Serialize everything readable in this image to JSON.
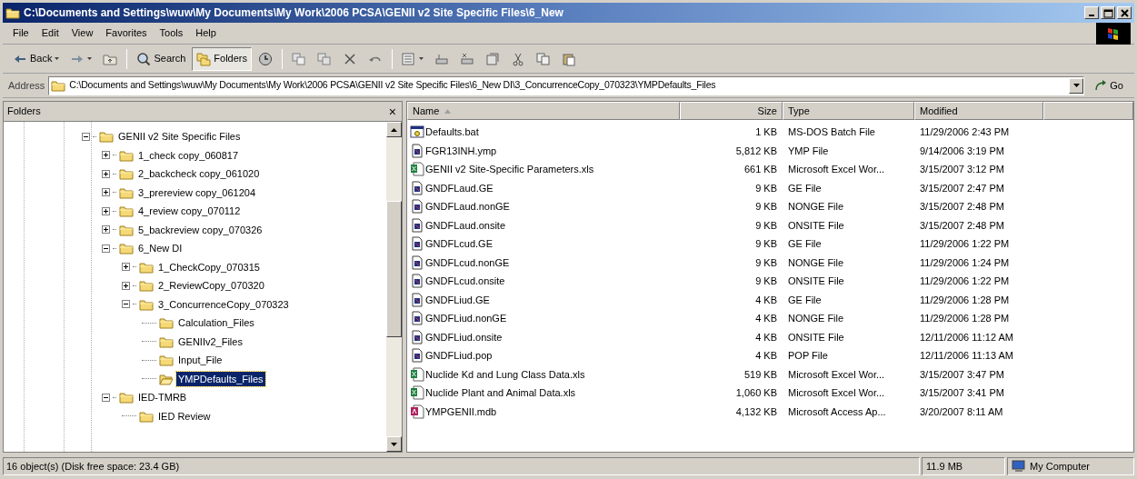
{
  "window": {
    "title": "C:\\Documents and Settings\\wuw\\My Documents\\My Work\\2006 PCSA\\GENII v2 Site Specific Files\\6_New"
  },
  "menu": [
    "File",
    "Edit",
    "View",
    "Favorites",
    "Tools",
    "Help"
  ],
  "toolbar": [
    {
      "kind": "back",
      "label": "Back",
      "pressed": false
    },
    {
      "kind": "forward",
      "pressed": false
    },
    {
      "kind": "up",
      "pressed": false
    },
    {
      "kind": "search",
      "label": "Search",
      "pressed": false
    },
    {
      "kind": "folders",
      "label": "Folders",
      "pressed": true
    },
    {
      "kind": "history",
      "pressed": false
    },
    {
      "kind": "moveto",
      "pressed": false
    },
    {
      "kind": "copyto",
      "pressed": false
    },
    {
      "kind": "delete",
      "pressed": false
    },
    {
      "kind": "undo",
      "pressed": false
    },
    {
      "kind": "views",
      "pressed": false
    },
    {
      "kind": "map",
      "pressed": false
    },
    {
      "kind": "unmap",
      "pressed": false
    },
    {
      "kind": "properties",
      "pressed": false
    },
    {
      "kind": "cut",
      "pressed": false
    },
    {
      "kind": "copy",
      "pressed": false
    },
    {
      "kind": "paste",
      "pressed": false
    }
  ],
  "address": {
    "label": "Address",
    "value": "C:\\Documents and Settings\\wuw\\My Documents\\My Work\\2006 PCSA\\GENII v2 Site Specific Files\\6_New DI\\3_ConcurrenceCopy_070323\\YMPDefaults_Files",
    "go": "Go"
  },
  "folders_pane": {
    "title": "Folders",
    "close": "×",
    "tree": [
      {
        "label": "GENII v2 Site Specific Files",
        "expanded": true,
        "selected": false,
        "children": [
          {
            "label": "1_check copy_060817",
            "expanded": false,
            "selected": false
          },
          {
            "label": "2_backcheck copy_061020",
            "expanded": false,
            "selected": false
          },
          {
            "label": "3_prereview copy_061204",
            "expanded": false,
            "selected": false
          },
          {
            "label": "4_review copy_070112",
            "expanded": false,
            "selected": false
          },
          {
            "label": "5_backreview copy_070326",
            "expanded": false,
            "selected": false
          },
          {
            "label": "6_New DI",
            "expanded": true,
            "selected": false,
            "children": [
              {
                "label": "1_CheckCopy_070315",
                "expanded": false,
                "selected": false
              },
              {
                "label": "2_ReviewCopy_070320",
                "expanded": false,
                "selected": false
              },
              {
                "label": "3_ConcurrenceCopy_070323",
                "expanded": true,
                "selected": false,
                "children": [
                  {
                    "label": "Calculation_Files",
                    "selected": false
                  },
                  {
                    "label": "GENIIv2_Files",
                    "selected": false
                  },
                  {
                    "label": "Input_File",
                    "selected": false
                  },
                  {
                    "label": "YMPDefaults_Files",
                    "selected": true
                  }
                ]
              }
            ]
          },
          {
            "label": "IED-TMRB",
            "expanded": true,
            "selected": false,
            "children": [
              {
                "label": "IED Review",
                "selected": false
              }
            ]
          }
        ]
      }
    ]
  },
  "file_list": {
    "columns": [
      {
        "label": "Name",
        "sorted": true
      },
      {
        "label": "Size",
        "sorted": false
      },
      {
        "label": "Type",
        "sorted": false
      },
      {
        "label": "Modified",
        "sorted": false
      }
    ],
    "rows": [
      {
        "kind": "batch",
        "name": "Defaults.bat",
        "size": "1 KB",
        "type": "MS-DOS Batch File",
        "modified": "11/29/2006 2:43 PM"
      },
      {
        "kind": "generic",
        "name": "FGR13INH.ymp",
        "size": "5,812 KB",
        "type": "YMP File",
        "modified": "9/14/2006 3:19 PM"
      },
      {
        "kind": "excel",
        "name": "GENII v2 Site-Specific Parameters.xls",
        "size": "661 KB",
        "type": "Microsoft Excel Wor...",
        "modified": "3/15/2007 3:12 PM"
      },
      {
        "kind": "generic",
        "name": "GNDFLaud.GE",
        "size": "9 KB",
        "type": "GE File",
        "modified": "3/15/2007 2:47 PM"
      },
      {
        "kind": "generic",
        "name": "GNDFLaud.nonGE",
        "size": "9 KB",
        "type": "NONGE File",
        "modified": "3/15/2007 2:48 PM"
      },
      {
        "kind": "generic",
        "name": "GNDFLaud.onsite",
        "size": "9 KB",
        "type": "ONSITE File",
        "modified": "3/15/2007 2:48 PM"
      },
      {
        "kind": "generic",
        "name": "GNDFLcud.GE",
        "size": "9 KB",
        "type": "GE File",
        "modified": "11/29/2006 1:22 PM"
      },
      {
        "kind": "generic",
        "name": "GNDFLcud.nonGE",
        "size": "9 KB",
        "type": "NONGE File",
        "modified": "11/29/2006 1:24 PM"
      },
      {
        "kind": "generic",
        "name": "GNDFLcud.onsite",
        "size": "9 KB",
        "type": "ONSITE File",
        "modified": "11/29/2006 1:22 PM"
      },
      {
        "kind": "generic",
        "name": "GNDFLiud.GE",
        "size": "4 KB",
        "type": "GE File",
        "modified": "11/29/2006 1:28 PM"
      },
      {
        "kind": "generic",
        "name": "GNDFLiud.nonGE",
        "size": "4 KB",
        "type": "NONGE File",
        "modified": "11/29/2006 1:28 PM"
      },
      {
        "kind": "generic",
        "name": "GNDFLiud.onsite",
        "size": "4 KB",
        "type": "ONSITE File",
        "modified": "12/11/2006 11:12 AM"
      },
      {
        "kind": "generic",
        "name": "GNDFLiud.pop",
        "size": "4 KB",
        "type": "POP File",
        "modified": "12/11/2006 11:13 AM"
      },
      {
        "kind": "excel",
        "name": "Nuclide Kd and Lung Class Data.xls",
        "size": "519 KB",
        "type": "Microsoft Excel Wor...",
        "modified": "3/15/2007 3:47 PM"
      },
      {
        "kind": "excel",
        "name": "Nuclide Plant and Animal Data.xls",
        "size": "1,060 KB",
        "type": "Microsoft Excel Wor...",
        "modified": "3/15/2007 3:41 PM"
      },
      {
        "kind": "access",
        "name": "YMPGENII.mdb",
        "size": "4,132 KB",
        "type": "Microsoft Access Ap...",
        "modified": "3/20/2007 8:11 AM"
      }
    ]
  },
  "status_bar": {
    "objects": "16 object(s) (Disk free space: 23.4 GB)",
    "size": "11.9 MB",
    "zone": "My Computer"
  }
}
